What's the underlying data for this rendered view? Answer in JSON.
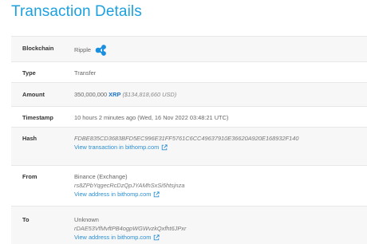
{
  "page": {
    "title": "Transaction Details"
  },
  "rows": {
    "blockchain": {
      "label": "Blockchain",
      "value": "Ripple",
      "icon": "ripple-logo-icon"
    },
    "type": {
      "label": "Type",
      "value": "Transfer"
    },
    "amount": {
      "label": "Amount",
      "quantity": "350,000,000",
      "currency": "XRP",
      "usd": "($134,818,660 USD)"
    },
    "timestamp": {
      "label": "Timestamp",
      "value": "10 hours 2 minutes ago (Wed, 16 Nov 2022 03:48:21 UTC)"
    },
    "hash": {
      "label": "Hash",
      "value": "FDBE835CD3683BFD5EC996E31FF5761C6CC49637910E36620A920E168932F140",
      "link_text": "View transaction in bithomp.com",
      "link_icon": "external-link-icon"
    },
    "from": {
      "label": "From",
      "name": "Binance (Exchange)",
      "address": "rs8ZPbYqgecRcDzQpJYAMhSxSi5htsjnza",
      "link_text": "View address in bithomp.com",
      "link_icon": "external-link-icon"
    },
    "to": {
      "label": "To",
      "name": "Unknown",
      "address": "rDAE53VfMvftPB4ogpWGWvzkQxfht6JPxr",
      "link_text": "View address in bithomp.com",
      "link_icon": "external-link-icon"
    }
  },
  "colors": {
    "title": "#1da1de",
    "link": "#2b8fd0",
    "xrp": "#1a73c7",
    "ripple_logo": "#1a8fe0"
  }
}
